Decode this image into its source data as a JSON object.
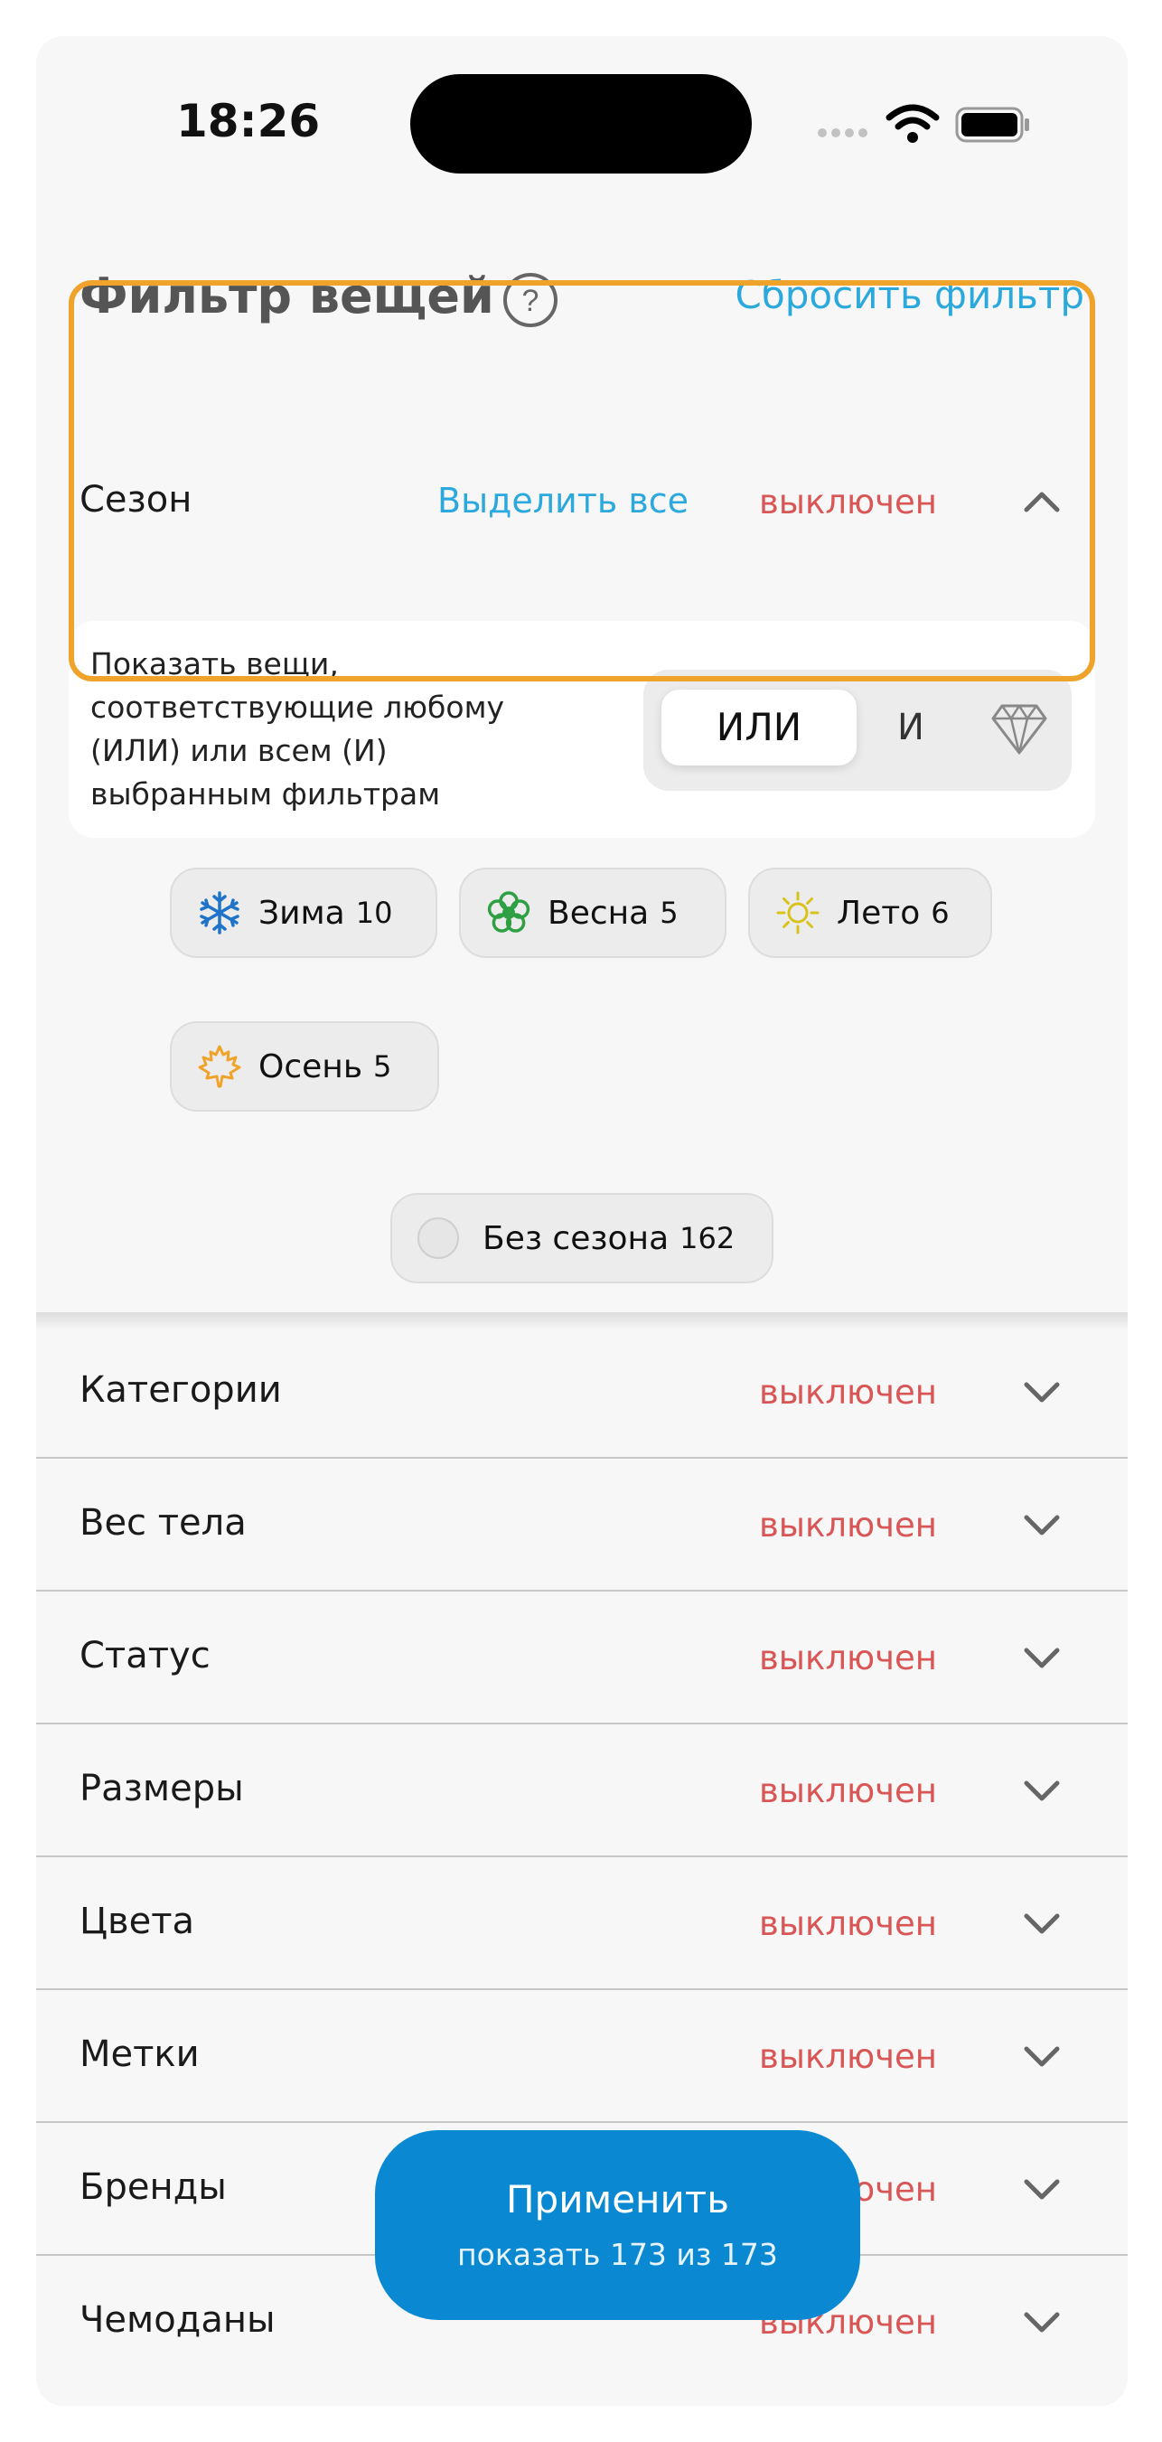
{
  "status_bar": {
    "time": "18:26"
  },
  "header": {
    "title": "Фильтр вещей",
    "reset_label": "Сбросить фильтр"
  },
  "season": {
    "title": "Сезон",
    "select_all_label": "Выделить все",
    "status": "выключен",
    "mode_description": "Показать вещи, соответствующие любому (ИЛИ) или всем (И) выбранным фильтрам",
    "mode_or_label": "ИЛИ",
    "mode_and_label": "И",
    "chips": [
      {
        "label": "Зима",
        "count": "10",
        "icon": "snowflake-icon",
        "color": "#1f74c9"
      },
      {
        "label": "Весна",
        "count": "5",
        "icon": "flower-icon",
        "color": "#2ea043"
      },
      {
        "label": "Лето",
        "count": "6",
        "icon": "sun-icon",
        "color": "#d9c21a"
      },
      {
        "label": "Осень",
        "count": "5",
        "icon": "maple-leaf-icon",
        "color": "#f0a32a"
      }
    ],
    "no_season": {
      "label": "Без сезона",
      "count": "162"
    }
  },
  "sections": [
    {
      "title": "Категории",
      "status": "выключен"
    },
    {
      "title": "Вес тела",
      "status": "выключен"
    },
    {
      "title": "Статус",
      "status": "выключен"
    },
    {
      "title": "Размеры",
      "status": "выключен"
    },
    {
      "title": "Цвета",
      "status": "выключен"
    },
    {
      "title": "Метки",
      "status": "выключен"
    },
    {
      "title": "Бренды",
      "status": "выключен"
    },
    {
      "title": "Чемоданы",
      "status": "выключен"
    }
  ],
  "apply_button": {
    "label": "Применить",
    "sublabel": "показать 173 из 173"
  },
  "colors": {
    "accent": "#2ba8dc",
    "status_off": "#d95656",
    "apply_bg": "#0a88d1",
    "highlight": "#f0a32a"
  }
}
